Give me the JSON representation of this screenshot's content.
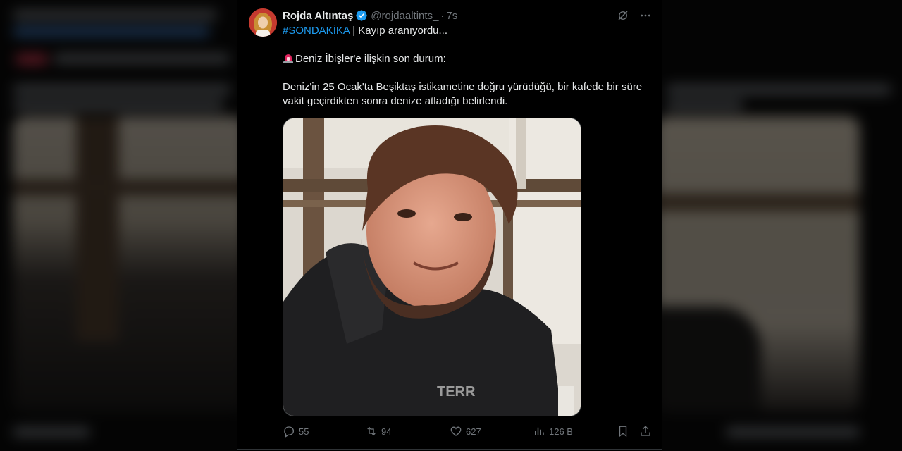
{
  "tweet": {
    "author": {
      "display_name": "Rojda Altıntaş",
      "handle": "@rojdaaltints_",
      "separator": "·",
      "time": "7s",
      "verified": true
    },
    "text": {
      "hashtag": "#SONDAKİKA",
      "line1_rest": " | Kayıp aranıyordu...",
      "line2": "Deniz İbişler'e ilişkin son durum:",
      "line3": "Deniz'in 25 Ocak'ta Beşiktaş istikametine doğru yürüdüğü, bir kafede bir süre vakit geçirdikten sonra denize atladığı belirlendi."
    },
    "photo_text": "TERR",
    "stats": {
      "replies": "55",
      "reposts": "94",
      "likes": "627",
      "views": "126 B"
    }
  },
  "colors": {
    "background": "#000000",
    "text": "#e7e9ea",
    "muted": "#71767b",
    "link": "#1d9bf0",
    "border": "#2f3336",
    "verified": "#1d9bf0"
  },
  "icons": [
    "grok-icon",
    "more-icon",
    "verified-badge-icon",
    "siren-emoji",
    "reply-icon",
    "repost-icon",
    "like-icon",
    "views-icon",
    "bookmark-icon",
    "share-icon"
  ]
}
